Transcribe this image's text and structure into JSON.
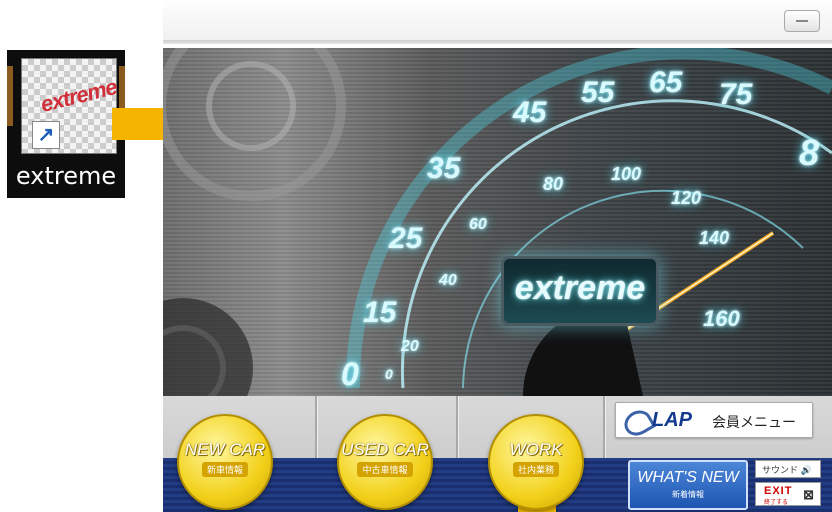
{
  "desktop": {
    "shortcut": {
      "label": "extreme",
      "icon_text": "extreme",
      "arrow": "↗"
    }
  },
  "hero": {
    "brand": "extreme",
    "speedometer": {
      "outer_numbers": [
        "0",
        "15",
        "25",
        "35",
        "45",
        "55",
        "65",
        "75",
        "8"
      ],
      "inner_numbers": [
        "0",
        "20",
        "40",
        "60",
        "80",
        "100",
        "120",
        "140",
        "160"
      ]
    }
  },
  "nav": {
    "new_car": {
      "title": "NEW CAR",
      "sub": "新車情報"
    },
    "used_car": {
      "title": "USED CAR",
      "sub": "中古車情報"
    },
    "work": {
      "title": "WORK",
      "sub": "社内業務"
    }
  },
  "member_menu": {
    "logo": "LAP",
    "label": "会員メニュー"
  },
  "whats_new": {
    "title": "WHAT'S NEW",
    "sub": "新着情報"
  },
  "sound": {
    "label": "サウンド",
    "icon": "🔊"
  },
  "exit": {
    "label": "EXIT",
    "sub": "終了する",
    "icon": "⊠"
  },
  "colors": {
    "accent_yellow": "#f2d11a",
    "arrow": "#f5b400",
    "navy": "#1a2f6f",
    "glow": "#54e6ff"
  }
}
